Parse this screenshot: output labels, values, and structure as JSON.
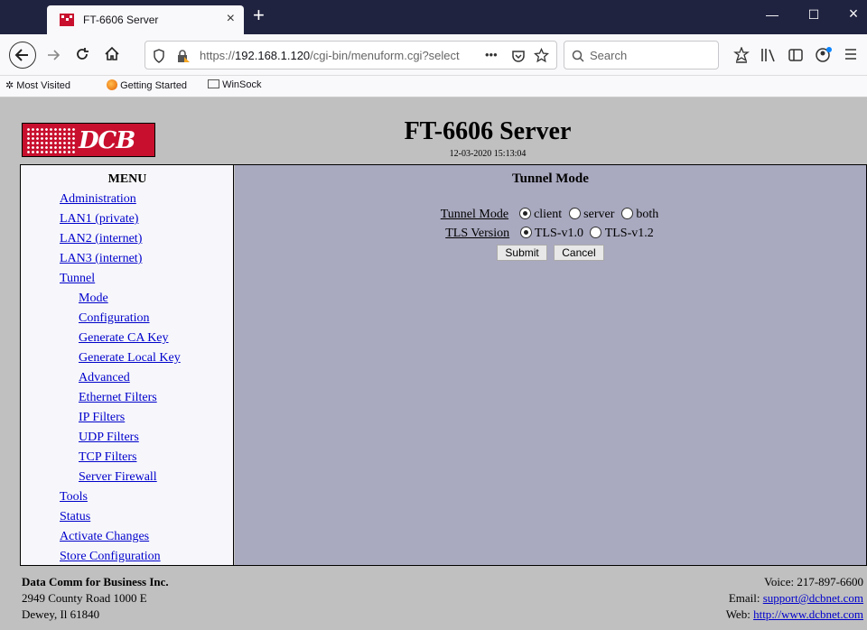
{
  "browser": {
    "tab_title": "FT-6606 Server",
    "tab_close": "×",
    "new_tab": "+",
    "url_prefix": "https://",
    "url_host": "192.168.1.120",
    "url_path": "/cgi-bin/menuform.cgi?select",
    "url_more": "•••",
    "search_placeholder": "Search",
    "window_minimize": "—",
    "window_maximize": "☐",
    "window_close": "×",
    "bookmarks": [
      "Most Visited",
      "Getting Started",
      "WinSock"
    ]
  },
  "header": {
    "logo_text": "DCB",
    "title": "FT-6606 Server",
    "datetime": "12-03-2020 15:13:04"
  },
  "menu": {
    "title": "MENU",
    "items": [
      {
        "label": "Administration"
      },
      {
        "label": "LAN1 (private)"
      },
      {
        "label": "LAN2 (internet)"
      },
      {
        "label": "LAN3 (internet)"
      },
      {
        "label": "Tunnel"
      },
      {
        "label": "Mode"
      },
      {
        "label": "Configuration"
      },
      {
        "label": "Generate CA Key"
      },
      {
        "label": "Generate Local Key"
      },
      {
        "label": "Advanced"
      },
      {
        "label": "Ethernet Filters"
      },
      {
        "label": "IP Filters"
      },
      {
        "label": "UDP Filters"
      },
      {
        "label": "TCP Filters"
      },
      {
        "label": "Server Firewall"
      },
      {
        "label": "Tools"
      },
      {
        "label": "Status"
      },
      {
        "label": "Activate Changes"
      },
      {
        "label": "Store Configuration"
      }
    ]
  },
  "content": {
    "title": "Tunnel Mode",
    "tunnel_mode": {
      "label": "Tunnel Mode",
      "options": [
        "client",
        "server",
        "both"
      ],
      "selected": "client"
    },
    "tls_version": {
      "label": "TLS Version",
      "options": [
        "TLS-v1.0",
        "TLS-v1.2"
      ],
      "selected": "TLS-v1.0"
    },
    "submit_label": "Submit",
    "cancel_label": "Cancel"
  },
  "footer": {
    "company": "Data Comm for Business Inc.",
    "address1": "2949 County Road 1000 E",
    "address2": "Dewey, Il 61840",
    "voice": "Voice: 217-897-6600",
    "email_label": "Email:",
    "email": "support@dcbnet.com",
    "web_label": "Web:",
    "web": "http://www.dcbnet.com"
  }
}
